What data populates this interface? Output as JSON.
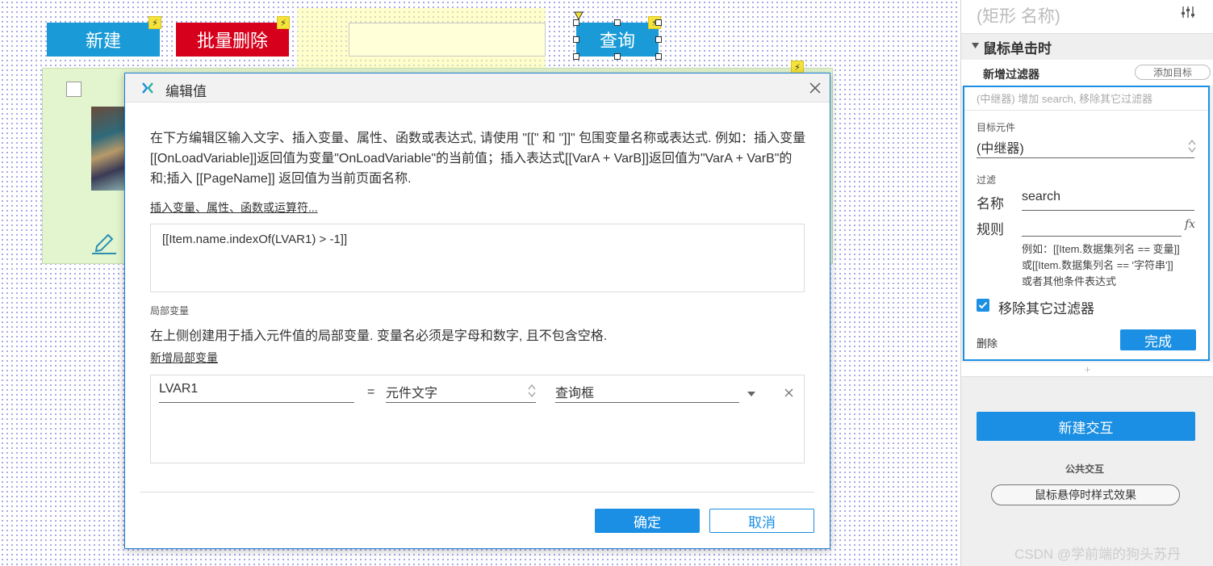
{
  "canvas": {
    "new_button": "新建",
    "batch_delete_button": "批量删除",
    "query_button": "查询",
    "bolt_glyph": "⚡",
    "colors": {
      "blue_button": "#1a9bd7",
      "red_button": "#d6001c",
      "repeater_bg": "#e2f5cf",
      "input_bg": "#ffffc8"
    }
  },
  "dialog": {
    "title": "编辑值",
    "description": "在下方编辑区输入文字、插入变量、属性、函数或表达式, 请使用 \"[[\" 和 \"]]\" 包围变量名称或表达式. 例如：插入变量[[OnLoadVariable]]返回值为变量\"OnLoadVariable\"的当前值；插入表达式[[VarA + VarB]]返回值为\"VarA + VarB\"的和;插入 [[PageName]] 返回值为当前页面名称.",
    "insert_link": "插入变量、属性、函数或运算符...",
    "expression": "[[Item.name.indexOf(LVAR1) >  -1]]",
    "local_vars_heading": "局部变量",
    "local_vars_desc": "在上侧创建用于插入元件值的局部变量. 变量名必须是字母和数字, 且不包含空格.",
    "add_local_var": "新增局部变量",
    "local_var": {
      "name": "LVAR1",
      "equals": "=",
      "type": "元件文字",
      "target": "查询框"
    },
    "ok_button": "确定",
    "cancel_button": "取消"
  },
  "panel": {
    "shape_name": "(矩形 名称)",
    "event_title": "鼠标单击时",
    "action_title": "新增过滤器",
    "add_target": "添加目标",
    "action_summary": "(中继器) 增加 search, 移除其它过滤器",
    "target_label": "目标元件",
    "target_value": "(中继器)",
    "filter_label": "过滤",
    "name_label": "名称",
    "name_value": "search",
    "rule_label": "规则",
    "fx_label": "fx",
    "rule_hint": "例如：[[Item.数据集列名 == 变量]]或[[Item.数据集列名 == '字符串']]或者其他条件表达式",
    "remove_others_label": "移除其它过滤器",
    "remove_others_checked": true,
    "delete_label": "删除",
    "done_button": "完成",
    "plus_glyph": "+",
    "new_interaction_button": "新建交互",
    "common_heading": "公共交互",
    "hover_style_button": "鼠标悬停时样式效果",
    "watermark": "CSDN @学前端的狗头苏丹"
  }
}
